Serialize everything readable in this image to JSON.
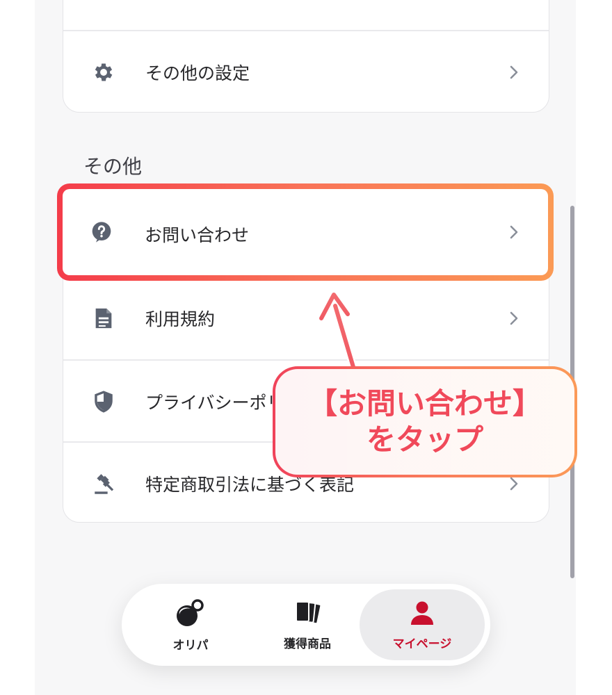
{
  "settings_card": {
    "other_settings_label": "その他の設定"
  },
  "section": {
    "title": "その他"
  },
  "menu": {
    "items": [
      {
        "label": "お問い合わせ",
        "icon": "help-circle-icon"
      },
      {
        "label": "利用規約",
        "icon": "document-icon"
      },
      {
        "label": "プライバシーポリシー",
        "icon": "shield-icon"
      },
      {
        "label": "特定商取引法に基づく表記",
        "icon": "gavel-icon"
      }
    ]
  },
  "callout": {
    "line1": "【お問い合わせ】",
    "line2": "をタップ"
  },
  "tabbar": {
    "tabs": [
      {
        "label": "オリパ",
        "icon": "oripa-icon",
        "active": false
      },
      {
        "label": "獲得商品",
        "icon": "cards-icon",
        "active": false
      },
      {
        "label": "マイページ",
        "icon": "user-icon",
        "active": true
      }
    ]
  },
  "colors": {
    "accent": "#c8102e",
    "highlight_start": "#f43c4a",
    "highlight_end": "#fb9a55",
    "icon_gray": "#5b6270"
  }
}
